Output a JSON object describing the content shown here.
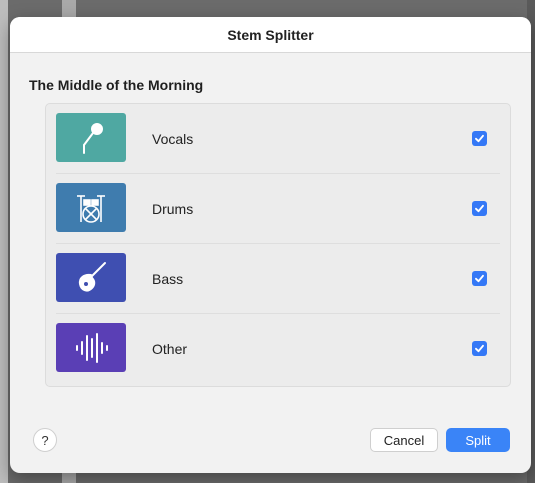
{
  "dialog": {
    "title": "Stem Splitter",
    "song_title": "The Middle of the Morning"
  },
  "stems": [
    {
      "label": "Vocals",
      "icon": "microphone-icon",
      "color": "#4fa8a2",
      "checked": true
    },
    {
      "label": "Drums",
      "icon": "drum-kit-icon",
      "color": "#3f7cae",
      "checked": true
    },
    {
      "label": "Bass",
      "icon": "bass-guitar-icon",
      "color": "#3f4fb1",
      "checked": true
    },
    {
      "label": "Other",
      "icon": "waveform-icon",
      "color": "#5a3fb5",
      "checked": true
    }
  ],
  "footer": {
    "help_label": "?",
    "cancel_label": "Cancel",
    "split_label": "Split"
  },
  "colors": {
    "accent": "#3a84f7",
    "checkbox": "#3478f6"
  }
}
